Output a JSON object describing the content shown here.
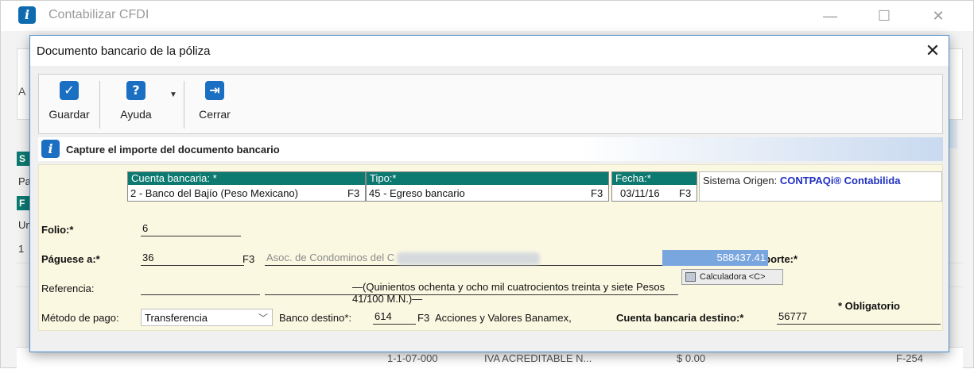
{
  "background_window": {
    "title": "Contabilizar CFDI",
    "min_glyph": "—",
    "max_glyph": "☐",
    "close_glyph": "✕",
    "stub_a": "A",
    "stub_s": "S",
    "stub_pa": "Pa",
    "stub_f": "F",
    "stub_un": "Un",
    "stub_1": "1",
    "bottom_row": {
      "account": "1-1-07-000",
      "name": "IVA ACREDITABLE N...",
      "amount": "$ 0.00",
      "ref": "F-254"
    }
  },
  "dialog": {
    "title": "Documento bancario de la póliza",
    "close_glyph": "✕",
    "toolbar": {
      "save_label": "Guardar",
      "help_label": "Ayuda",
      "close_label": "Cerrar",
      "save_glyph": "✓",
      "help_glyph": "?",
      "close_glyph": "⇥"
    },
    "info_message": "Capture el importe del documento bancario",
    "info_glyph": "i",
    "header": {
      "cuenta_label": "Cuenta bancaria: *",
      "cuenta_value": "2 - Banco del Bajío (Peso Mexicano)",
      "tipo_label": "Tipo:*",
      "tipo_value": "45 - Egreso bancario",
      "fecha_label": "Fecha:*",
      "fecha_value": "03/11/16",
      "f3": "F3",
      "sistema_label": "Sistema Origen:",
      "sistema_value": "CONTPAQi® Contabilida"
    },
    "form": {
      "folio_label": "Folio:*",
      "folio_value": "6",
      "paguese_label": "Páguese a:*",
      "paguese_code": "36",
      "paguese_name": "Asoc. de Condominos del C",
      "importe_label": "Importe:*",
      "importe_value": "588437.41",
      "calculadora_label": "Calculadora <C>",
      "referencia_label": "Referencia:",
      "amount_in_words": "—(Quinientos ochenta y ocho mil cuatrocientos treinta y siete Pesos 41/100 M.N.)—",
      "metodo_label": "Método de pago:",
      "metodo_value": "Transferencia",
      "banco_destino_label": "Banco destino*:",
      "banco_destino_code": "614",
      "banco_destino_name": "Acciones y Valores Banamex,",
      "cuenta_destino_label": "Cuenta bancaria destino:*",
      "cuenta_destino_value": "56777",
      "f3": "F3"
    },
    "obligatorio_note": "* Obligatorio"
  },
  "colors": {
    "header_teal": "#0d7a71",
    "accent_blue": "#1a6fc2",
    "form_bg": "#fbf8e2",
    "importe_bg": "#7aa6e0",
    "sistema_blue": "#2030c0"
  }
}
